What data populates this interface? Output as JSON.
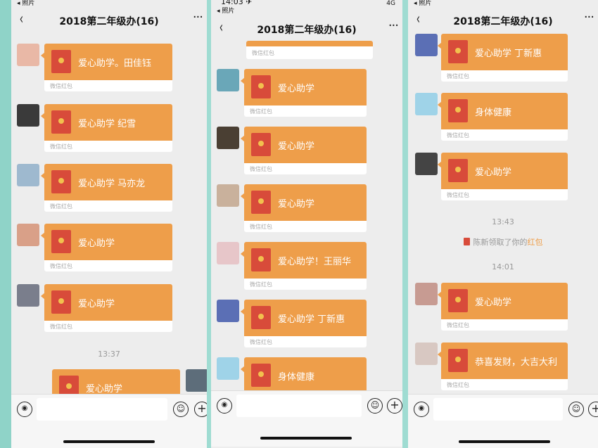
{
  "colors": {
    "packet_orange": "#ee9e4a",
    "envelope_red": "#d84b3a",
    "chat_bg": "#ededed",
    "teal_background": "#9fdcd2"
  },
  "panels": [
    {
      "status": {
        "back_label": "◂ 照片",
        "time": "",
        "right": ""
      },
      "nav": {
        "back_icon": "‹",
        "title": "2018第二年级办(16)",
        "more_icon": "···"
      },
      "messages": [
        {
          "type": "packet",
          "text": "爱心助学。田佳钰",
          "footer": "微信红包",
          "avatar": "#e9b8a6"
        },
        {
          "type": "packet",
          "text": "爱心助学 纪雪",
          "footer": "微信红包",
          "avatar": "#3a3a3a"
        },
        {
          "type": "packet",
          "text": "爱心助学 马亦龙",
          "footer": "微信红包",
          "avatar": "#9eb9cf"
        },
        {
          "type": "packet",
          "text": "爱心助学",
          "footer": "微信红包",
          "avatar": "#d9a088"
        },
        {
          "type": "packet",
          "text": "爱心助学",
          "footer": "微信红包",
          "avatar": "#7a7e8c"
        },
        {
          "type": "time",
          "text": "13:37"
        },
        {
          "type": "packet-self",
          "text": "爱心助学",
          "footer": "",
          "avatar": "#5d6d7a"
        }
      ]
    },
    {
      "status": {
        "back_label": "◂ 照片",
        "time": "14:03 ✈",
        "right": "4G"
      },
      "nav": {
        "back_icon": "‹",
        "title": "2018第二年级办(16)",
        "more_icon": "···"
      },
      "messages": [
        {
          "type": "packet-partial",
          "text": "",
          "footer": "微信红包",
          "avatar": ""
        },
        {
          "type": "packet",
          "text": "爱心助学",
          "footer": "微信红包",
          "avatar": "#6aa7b8"
        },
        {
          "type": "packet",
          "text": "爱心助学",
          "footer": "微信红包",
          "avatar": "#4a3f33"
        },
        {
          "type": "packet",
          "text": "爱心助学",
          "footer": "微信红包",
          "avatar": "#c9b19c"
        },
        {
          "type": "packet",
          "text": "爱心助学！王丽华",
          "footer": "微信红包",
          "avatar": "#e7c6c9"
        },
        {
          "type": "packet",
          "text": "爱心助学 丁新惠",
          "footer": "微信红包",
          "avatar": "#5b6fb5"
        },
        {
          "type": "packet",
          "text": "身体健康",
          "footer": "",
          "avatar": "#9fd3e8"
        }
      ]
    },
    {
      "status": {
        "back_label": "◂ 照片",
        "time": "",
        "right": ""
      },
      "nav": {
        "back_icon": "‹",
        "title": "2018第二年级办(16)",
        "more_icon": "···"
      },
      "messages": [
        {
          "type": "packet",
          "text": "爱心助学 丁新惠",
          "footer": "微信红包",
          "avatar": "#5b6fb5"
        },
        {
          "type": "packet",
          "text": "身体健康",
          "footer": "微信红包",
          "avatar": "#9fd3e8"
        },
        {
          "type": "packet",
          "text": "爱心助学",
          "footer": "微信红包",
          "avatar": "#444444"
        },
        {
          "type": "time",
          "text": "13:43"
        },
        {
          "type": "notice",
          "pre": "陈新领取了你的",
          "hl": "红包"
        },
        {
          "type": "time",
          "text": "14:01"
        },
        {
          "type": "packet",
          "text": "爱心助学",
          "footer": "微信红包",
          "avatar": "#c79b92"
        },
        {
          "type": "packet",
          "text": "恭喜发财，大吉大利",
          "footer": "微信红包",
          "avatar": "#d8c8c2"
        }
      ]
    }
  ]
}
